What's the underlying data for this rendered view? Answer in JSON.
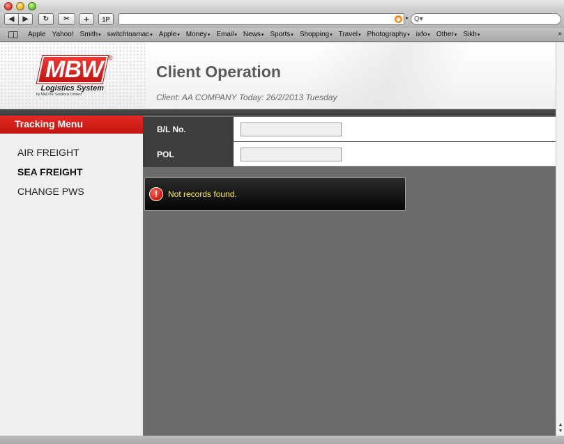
{
  "browser": {
    "toolbar": {
      "back": "◀",
      "forward": "▶",
      "reload": "↻",
      "snap": "✂",
      "add": "+",
      "onepassword": "1P"
    },
    "address_value": "",
    "search_value": "Q▾",
    "bookmarks": [
      {
        "label": "Apple",
        "menu": false
      },
      {
        "label": "Yahoo!",
        "menu": false
      },
      {
        "label": "Smith",
        "menu": true
      },
      {
        "label": "switchtoamac",
        "menu": true
      },
      {
        "label": "Apple",
        "menu": true
      },
      {
        "label": "Money",
        "menu": true
      },
      {
        "label": "Email",
        "menu": true
      },
      {
        "label": "News",
        "menu": true
      },
      {
        "label": "Sports",
        "menu": true
      },
      {
        "label": "Shopping",
        "menu": true
      },
      {
        "label": "Travel",
        "menu": true
      },
      {
        "label": "Photography",
        "menu": true
      },
      {
        "label": "ixfo",
        "menu": true
      },
      {
        "label": "Other",
        "menu": true
      },
      {
        "label": "Sikh",
        "menu": true
      }
    ],
    "bookmarks_more": "»"
  },
  "logo": {
    "text": "MBW",
    "reg": "®",
    "subtitle": "Logistics System",
    "tagline": "by MADTec Solutions Limited"
  },
  "header": {
    "title": "Client Operation",
    "client_line": "Client: AA COMPANY Today: 26/2/2013 Tuesday"
  },
  "sidebar": {
    "title": "Tracking Menu",
    "items": [
      {
        "label": "AIR FREIGHT",
        "active": false
      },
      {
        "label": "SEA FREIGHT",
        "active": true
      },
      {
        "label": "CHANGE PWS",
        "active": false
      }
    ]
  },
  "form": {
    "bl_label": "B/L No.",
    "bl_value": "",
    "pol_label": "POL",
    "pol_value": ""
  },
  "alert": {
    "icon": "!",
    "message": "Not records found."
  },
  "colors": {
    "accent_red": "#c11710",
    "content_bg": "#6a6b6d",
    "alert_text": "#ffeb3b"
  }
}
